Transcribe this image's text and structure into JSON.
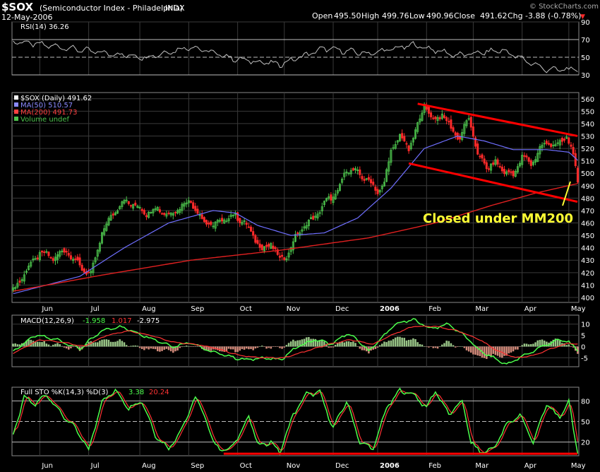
{
  "header": {
    "symbol": "$SOX",
    "name": "(Semiconductor Index - Philadelphia)",
    "exchange": "INDX",
    "date": "12-May-2006",
    "brand": "© StockCharts.com",
    "quote": {
      "open_label": "Open",
      "open": "495.50",
      "high_label": "High",
      "high": "499.76",
      "low_label": "Low",
      "low": "490.96",
      "close_label": "Close",
      "close": "491.62",
      "chg_label": "Chg",
      "chg": "-3.88 (-0.78%)",
      "chg_arrow": "▼"
    }
  },
  "colors": {
    "background": "#000000",
    "grid": "#3a3a3a",
    "frame": "#8a8a8a",
    "text": "#ffffff",
    "candle_up": "#4cc24c",
    "candle_down": "#ff2a2a",
    "ma50": "#6f6fff",
    "ma200": "#e02020",
    "annotation": "#ff0000",
    "annotation_text": "#ffff33",
    "oscillator_main": "#4cff4c",
    "oscillator_signal": "#ff3333",
    "rsi_line": "#c0c0c0",
    "hist_pos": "#98c486",
    "hist_neg": "#d28a7a"
  },
  "chart_data": [
    {
      "type": "line",
      "panel": "rsi",
      "legend": "RSI(14) 36.26",
      "ylim": [
        30,
        90
      ],
      "yticks": [
        "90",
        "70",
        "50",
        "30"
      ],
      "reference_lines": [
        70,
        50,
        30
      ],
      "x": [
        0,
        20,
        40,
        60,
        80,
        100,
        120,
        140,
        160,
        180,
        200,
        220,
        240
      ],
      "values": [
        68,
        62,
        55,
        50,
        62,
        48,
        42,
        60,
        54,
        64,
        52,
        58,
        36
      ]
    },
    {
      "type": "candlestick",
      "panel": "price",
      "legend": [
        {
          "label": "$SOX (Daily) 491.62",
          "color": "#ffffff"
        },
        {
          "label": "MA(50) 510.57",
          "color": "#8a8aff"
        },
        {
          "label": "MA(200) 491.73",
          "color": "#ff4040"
        },
        {
          "label": "Volume undef",
          "color": "#4cc24c"
        }
      ],
      "ylim": [
        396,
        565
      ],
      "yticks": [
        "560",
        "550",
        "540",
        "530",
        "520",
        "510",
        "500",
        "490",
        "480",
        "470",
        "460",
        "450",
        "440",
        "430",
        "420",
        "410",
        "400"
      ],
      "x_months": [
        "Jun",
        "Jul",
        "Aug",
        "Sep",
        "Oct",
        "Nov",
        "Dec",
        "2006",
        "Feb",
        "Mar",
        "Apr",
        "May"
      ],
      "x_month_index": [
        12,
        34,
        57,
        79,
        101,
        122,
        144,
        164,
        186,
        207,
        229,
        250
      ],
      "bar_count": 255,
      "close_anchors": [
        [
          0,
          405
        ],
        [
          6,
          422
        ],
        [
          12,
          436
        ],
        [
          18,
          432
        ],
        [
          24,
          438
        ],
        [
          30,
          425
        ],
        [
          35,
          418
        ],
        [
          40,
          452
        ],
        [
          45,
          468
        ],
        [
          50,
          478
        ],
        [
          55,
          474
        ],
        [
          60,
          468
        ],
        [
          65,
          472
        ],
        [
          70,
          466
        ],
        [
          75,
          473
        ],
        [
          80,
          478
        ],
        [
          85,
          462
        ],
        [
          90,
          458
        ],
        [
          95,
          463
        ],
        [
          100,
          466
        ],
        [
          104,
          460
        ],
        [
          108,
          450
        ],
        [
          112,
          438
        ],
        [
          116,
          444
        ],
        [
          120,
          430
        ],
        [
          124,
          436
        ],
        [
          128,
          452
        ],
        [
          134,
          462
        ],
        [
          138,
          470
        ],
        [
          142,
          480
        ],
        [
          146,
          484
        ],
        [
          150,
          504
        ],
        [
          155,
          500
        ],
        [
          160,
          494
        ],
        [
          164,
          485
        ],
        [
          167,
          492
        ],
        [
          170,
          518
        ],
        [
          174,
          530
        ],
        [
          178,
          520
        ],
        [
          182,
          538
        ],
        [
          185,
          556
        ],
        [
          189,
          542
        ],
        [
          193,
          548
        ],
        [
          197,
          536
        ],
        [
          201,
          528
        ],
        [
          205,
          545
        ],
        [
          209,
          515
        ],
        [
          213,
          505
        ],
        [
          217,
          508
        ],
        [
          221,
          502
        ],
        [
          225,
          498
        ],
        [
          229,
          514
        ],
        [
          233,
          507
        ],
        [
          237,
          520
        ],
        [
          241,
          525
        ],
        [
          245,
          522
        ],
        [
          249,
          530
        ],
        [
          252,
          515
        ],
        [
          254,
          492
        ]
      ],
      "ma50_anchors": [
        [
          0,
          403
        ],
        [
          30,
          417
        ],
        [
          50,
          440
        ],
        [
          70,
          460
        ],
        [
          90,
          470
        ],
        [
          100,
          468
        ],
        [
          110,
          458
        ],
        [
          125,
          450
        ],
        [
          140,
          452
        ],
        [
          155,
          464
        ],
        [
          170,
          488
        ],
        [
          185,
          520
        ],
        [
          200,
          530
        ],
        [
          212,
          526
        ],
        [
          225,
          519
        ],
        [
          240,
          519
        ],
        [
          250,
          517
        ],
        [
          254,
          510.57
        ]
      ],
      "ma200_anchors": [
        [
          0,
          405
        ],
        [
          40,
          418
        ],
        [
          80,
          430
        ],
        [
          120,
          438
        ],
        [
          160,
          448
        ],
        [
          190,
          460
        ],
        [
          215,
          474
        ],
        [
          235,
          484
        ],
        [
          254,
          491.73
        ]
      ],
      "trend_channel": {
        "upper": [
          [
            182,
            556
          ],
          [
            254,
            530
          ]
        ],
        "lower": [
          [
            178,
            508
          ],
          [
            254,
            477
          ]
        ]
      },
      "annotation": "Closed under MM200"
    },
    {
      "type": "line",
      "panel": "macd",
      "legend_prefix": "MACD(12,26,9)",
      "legend_values": [
        "-1.958",
        "1.017",
        "-2.975"
      ],
      "ylim": [
        -9,
        14
      ],
      "yticks": [
        "10",
        "5",
        "0",
        "-5"
      ],
      "macd_anchors": [
        [
          0,
          -2
        ],
        [
          10,
          5
        ],
        [
          20,
          3
        ],
        [
          30,
          -1
        ],
        [
          40,
          7
        ],
        [
          48,
          9
        ],
        [
          56,
          6
        ],
        [
          64,
          3
        ],
        [
          72,
          0
        ],
        [
          80,
          2
        ],
        [
          88,
          -2
        ],
        [
          96,
          -4
        ],
        [
          104,
          -6
        ],
        [
          112,
          -5
        ],
        [
          120,
          -6
        ],
        [
          128,
          0
        ],
        [
          136,
          3
        ],
        [
          144,
          1
        ],
        [
          150,
          6
        ],
        [
          156,
          2
        ],
        [
          160,
          -2
        ],
        [
          166,
          4
        ],
        [
          172,
          10
        ],
        [
          180,
          12
        ],
        [
          188,
          8
        ],
        [
          196,
          10
        ],
        [
          204,
          4
        ],
        [
          210,
          -2
        ],
        [
          216,
          -5
        ],
        [
          222,
          -8
        ],
        [
          228,
          -5
        ],
        [
          234,
          -2
        ],
        [
          240,
          1
        ],
        [
          246,
          3
        ],
        [
          250,
          2
        ],
        [
          254,
          -1.958
        ]
      ],
      "signal_anchors": [
        [
          0,
          -3
        ],
        [
          12,
          3
        ],
        [
          22,
          2
        ],
        [
          32,
          0
        ],
        [
          42,
          5
        ],
        [
          52,
          7
        ],
        [
          62,
          5
        ],
        [
          72,
          2
        ],
        [
          82,
          1
        ],
        [
          92,
          -1
        ],
        [
          102,
          -4
        ],
        [
          112,
          -5
        ],
        [
          122,
          -5
        ],
        [
          132,
          -2
        ],
        [
          142,
          1
        ],
        [
          152,
          3
        ],
        [
          162,
          1
        ],
        [
          170,
          5
        ],
        [
          180,
          9
        ],
        [
          190,
          9
        ],
        [
          200,
          7
        ],
        [
          210,
          3
        ],
        [
          218,
          -2
        ],
        [
          226,
          -5
        ],
        [
          234,
          -4
        ],
        [
          242,
          -1
        ],
        [
          250,
          1.5
        ],
        [
          254,
          1.017
        ]
      ]
    },
    {
      "type": "line",
      "panel": "stochastic",
      "legend_prefix": "Full STO %K(14,3) %D(3)",
      "legend_values": [
        "3.38",
        "20.24"
      ],
      "ylim": [
        0,
        100
      ],
      "yticks": [
        "80",
        "50",
        "20"
      ],
      "reference_lines": [
        80,
        50,
        20
      ],
      "k_anchors": [
        [
          0,
          30
        ],
        [
          5,
          85
        ],
        [
          10,
          75
        ],
        [
          15,
          90
        ],
        [
          22,
          60
        ],
        [
          28,
          40
        ],
        [
          34,
          8
        ],
        [
          40,
          80
        ],
        [
          46,
          95
        ],
        [
          52,
          70
        ],
        [
          58,
          80
        ],
        [
          64,
          30
        ],
        [
          70,
          10
        ],
        [
          76,
          40
        ],
        [
          82,
          85
        ],
        [
          86,
          60
        ],
        [
          90,
          20
        ],
        [
          96,
          5
        ],
        [
          102,
          30
        ],
        [
          106,
          60
        ],
        [
          110,
          15
        ],
        [
          116,
          20
        ],
        [
          120,
          5
        ],
        [
          126,
          60
        ],
        [
          132,
          90
        ],
        [
          138,
          92
        ],
        [
          144,
          40
        ],
        [
          150,
          80
        ],
        [
          156,
          20
        ],
        [
          162,
          10
        ],
        [
          168,
          70
        ],
        [
          174,
          95
        ],
        [
          180,
          90
        ],
        [
          186,
          70
        ],
        [
          190,
          95
        ],
        [
          196,
          60
        ],
        [
          202,
          80
        ],
        [
          206,
          20
        ],
        [
          210,
          5
        ],
        [
          216,
          10
        ],
        [
          222,
          45
        ],
        [
          228,
          60
        ],
        [
          234,
          20
        ],
        [
          240,
          75
        ],
        [
          246,
          55
        ],
        [
          250,
          80
        ],
        [
          254,
          3.38
        ]
      ],
      "trend_line": [
        [
          96,
          3
        ],
        [
          254,
          3
        ]
      ]
    }
  ]
}
